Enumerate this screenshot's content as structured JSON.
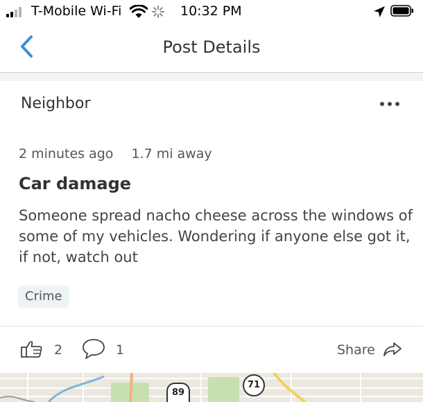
{
  "status_bar": {
    "carrier": "T-Mobile Wi-Fi",
    "time": "10:32 PM"
  },
  "nav": {
    "title": "Post Details",
    "back_icon": "chevron-left-icon"
  },
  "post": {
    "author": "Neighbor",
    "time_ago": "2 minutes ago",
    "distance": "1.7 mi away",
    "title": "Car damage",
    "body": "Someone spread nacho cheese across the windows of some of my vehicles. Wondering if anyone else got it, if not, watch out",
    "tag": "Crime"
  },
  "actions": {
    "like_count": "2",
    "comment_count": "1",
    "share_label": "Share"
  },
  "map": {
    "shields": [
      "89",
      "71"
    ]
  },
  "colors": {
    "accent": "#3d8fd6",
    "text": "#333333",
    "tag_bg": "#eef3f5"
  }
}
